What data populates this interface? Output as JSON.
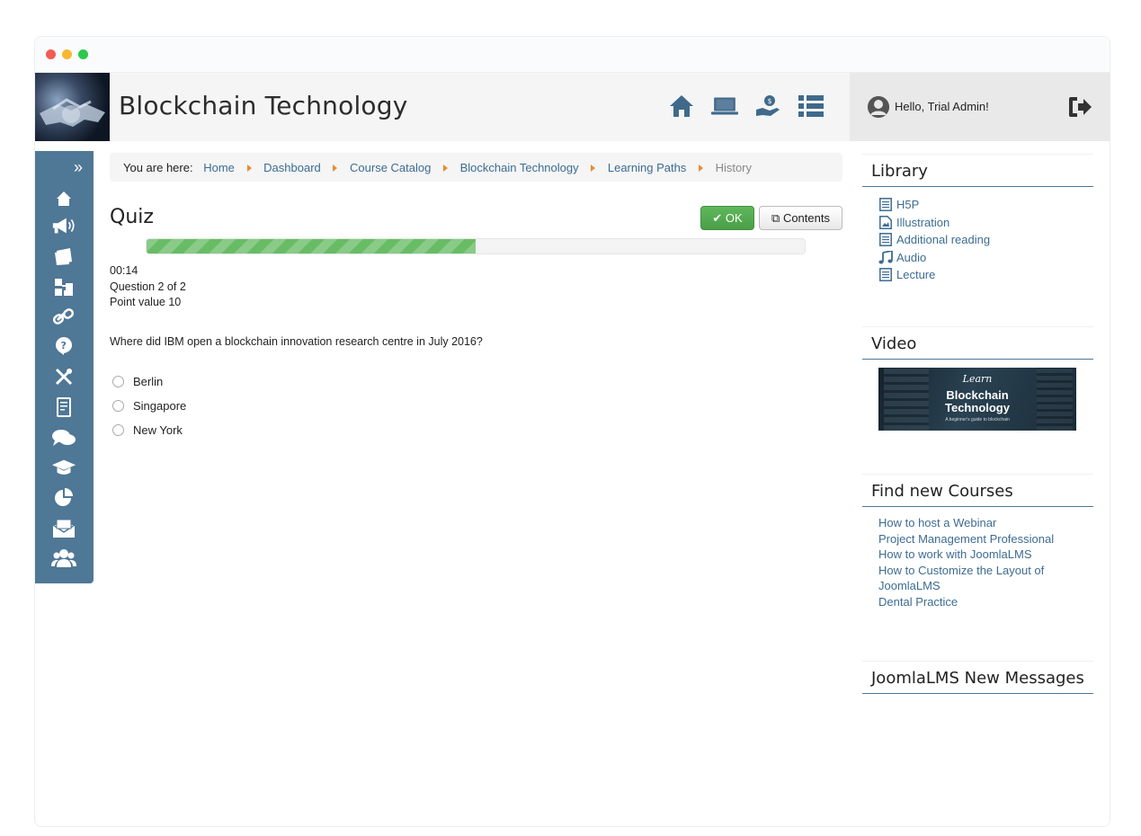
{
  "header": {
    "site_title": "Blockchain Technology",
    "icons": [
      "home-icon",
      "laptop-icon",
      "money-hand-icon",
      "list-icon"
    ]
  },
  "user": {
    "greeting": "Hello, Trial Admin!"
  },
  "sidenav": {
    "expand_label": "»",
    "icons": [
      "home-icon",
      "megaphone-icon",
      "documents-icon",
      "hierarchy-icon",
      "link-icon",
      "question-icon",
      "tools-icon",
      "document-icon",
      "chat-icon",
      "graduation-icon",
      "pie-chart-icon",
      "mail-icon",
      "users-icon"
    ]
  },
  "breadcrumb": {
    "label": "You are here:",
    "items": [
      "Home",
      "Dashboard",
      "Course Catalog",
      "Blockchain Technology",
      "Learning Paths"
    ],
    "current": "History"
  },
  "quiz": {
    "title": "Quiz",
    "ok_label": "OK",
    "contents_label": "Contents",
    "progress": 0.5,
    "timer": "00:14",
    "question_counter": "Question 2 of 2",
    "point_value": "Point value 10",
    "question": "Where did IBM open a blockchain innovation research centre in July 2016?",
    "answers": [
      "Berlin",
      "Singapore",
      "New York"
    ]
  },
  "library": {
    "title": "Library",
    "items": [
      {
        "label": "H5P",
        "icon": "document-icon"
      },
      {
        "label": "Illustration",
        "icon": "image-icon"
      },
      {
        "label": "Additional reading",
        "icon": "document-icon"
      },
      {
        "label": "Audio",
        "icon": "music-icon"
      },
      {
        "label": "Lecture",
        "icon": "document-icon"
      }
    ]
  },
  "video": {
    "title": "Video",
    "thumb_learn": "Learn",
    "thumb_title_1": "Blockchain",
    "thumb_title_2": "Technology",
    "thumb_sub": "A beginner's guide to blockchain"
  },
  "find_courses": {
    "title": "Find new Courses",
    "links": [
      "How to host a Webinar",
      "Project Management Professional",
      "How to work with JoomlaLMS",
      "How to Customize the Layout of JoomlaLMS",
      "Dental Practice"
    ]
  },
  "messages": {
    "title": "JoomlaLMS New Messages"
  },
  "colors": {
    "accent": "#4f7796",
    "link": "#3d6c92",
    "ok_green": "#5cb85c",
    "breadcrumb_sep": "#e98b33"
  }
}
